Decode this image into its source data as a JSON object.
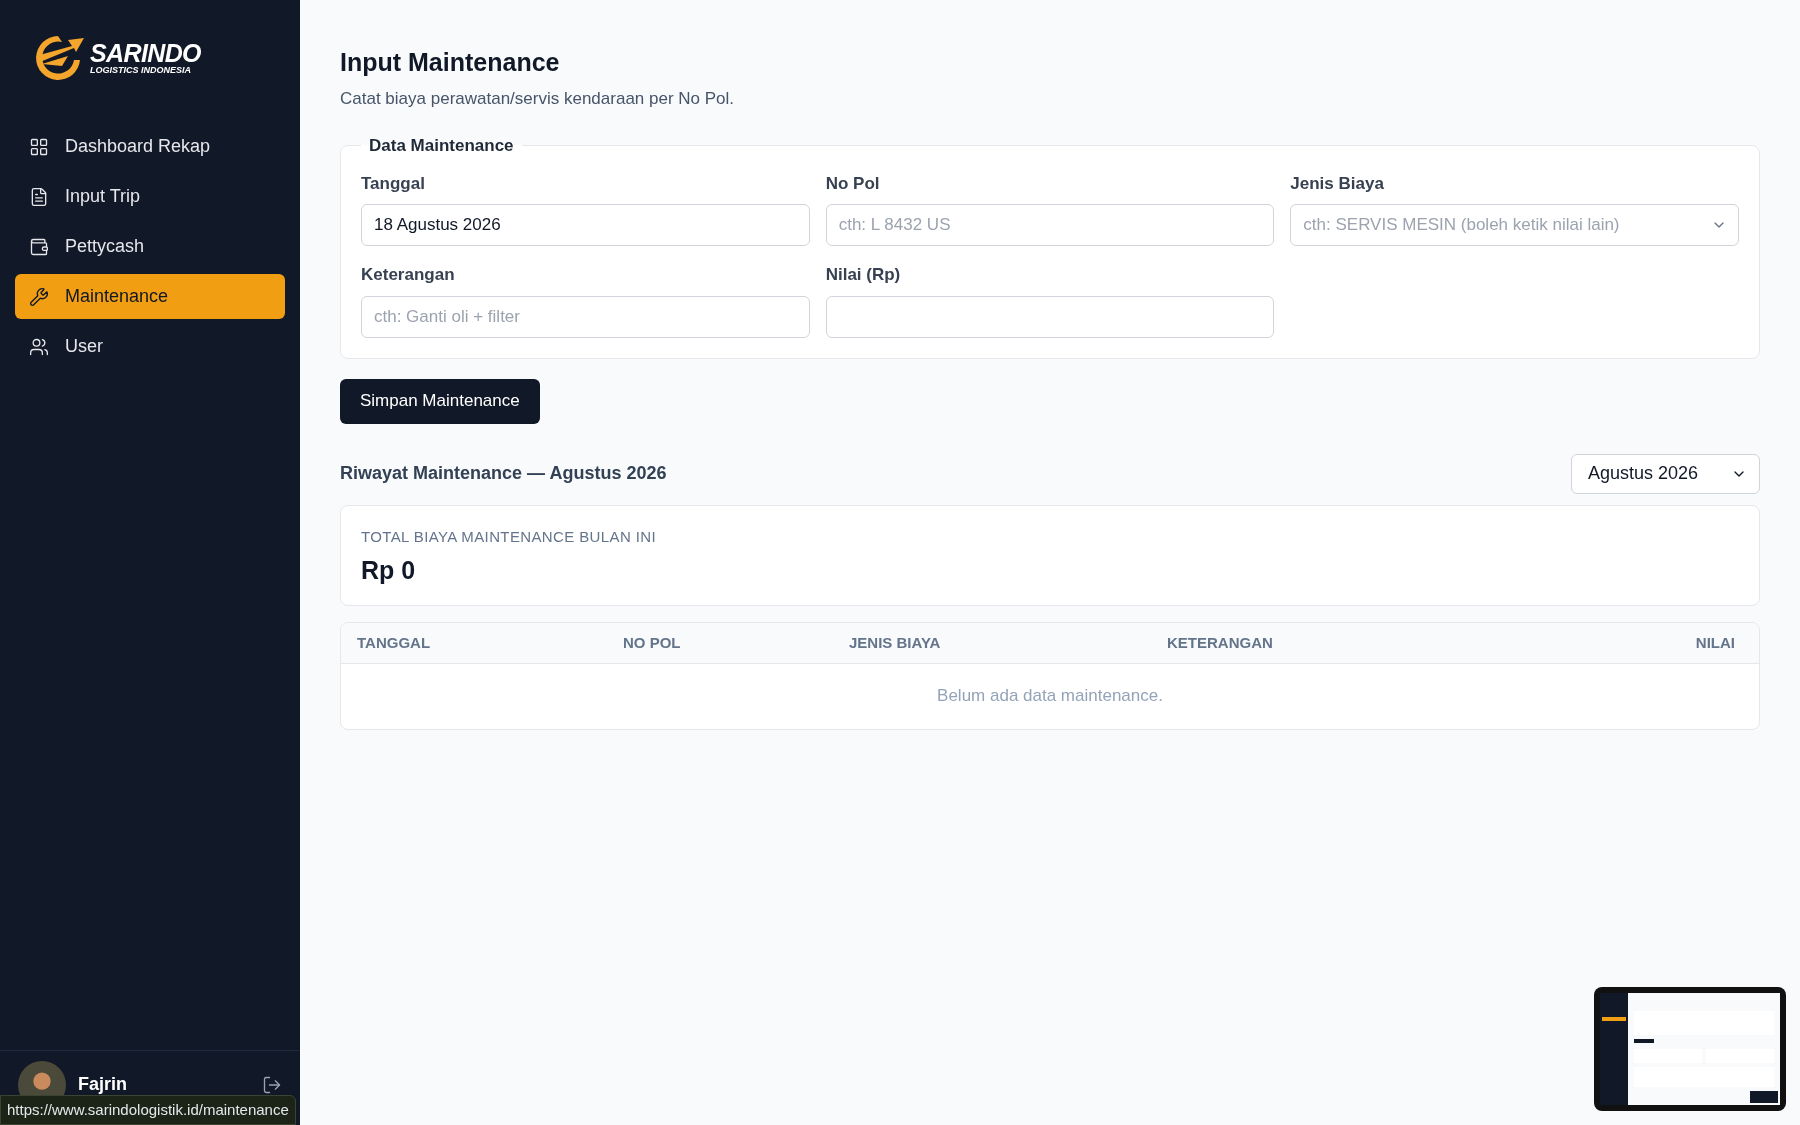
{
  "brand": {
    "name": "SARINDO",
    "tagline": "LOGISTICS INDONESIA"
  },
  "sidebar": {
    "items": [
      {
        "label": "Dashboard Rekap",
        "selected": false
      },
      {
        "label": "Input Trip",
        "selected": false
      },
      {
        "label": "Pettycash",
        "selected": false
      },
      {
        "label": "Maintenance",
        "selected": true
      },
      {
        "label": "User",
        "selected": false
      }
    ],
    "user": {
      "name": "Fajrin"
    }
  },
  "page": {
    "title": "Input Maintenance",
    "subtitle": "Catat biaya perawatan/servis kendaraan per No Pol."
  },
  "form": {
    "legend": "Data Maintenance",
    "fields": [
      {
        "label": "Tanggal",
        "kind": "text",
        "value": "18 Agustus 2026"
      },
      {
        "label": "No Pol",
        "kind": "text",
        "placeholder": "cth: L 8432 US"
      },
      {
        "label": "Jenis Biaya",
        "kind": "combo",
        "placeholder": "cth: SERVIS MESIN (boleh ketik nilai lain)"
      },
      {
        "label": "Keterangan",
        "kind": "text",
        "placeholder": "cth: Ganti oli + filter"
      },
      {
        "label": "Nilai (Rp)",
        "kind": "text"
      }
    ],
    "submit": "Simpan Maintenance"
  },
  "history": {
    "title": "Riwayat Maintenance — Agustus 2026",
    "month": "Agustus 2026",
    "total_label": "TOTAL BIAYA MAINTENANCE BULAN INI",
    "total": "Rp 0",
    "table": {
      "columns": [
        "TANGGAL",
        "NO POL",
        "JENIS BIAYA",
        "KETERANGAN",
        "NILAI"
      ],
      "empty": "Belum ada data maintenance."
    }
  },
  "status_url": "https://www.sarindologistik.id/maintenance"
}
